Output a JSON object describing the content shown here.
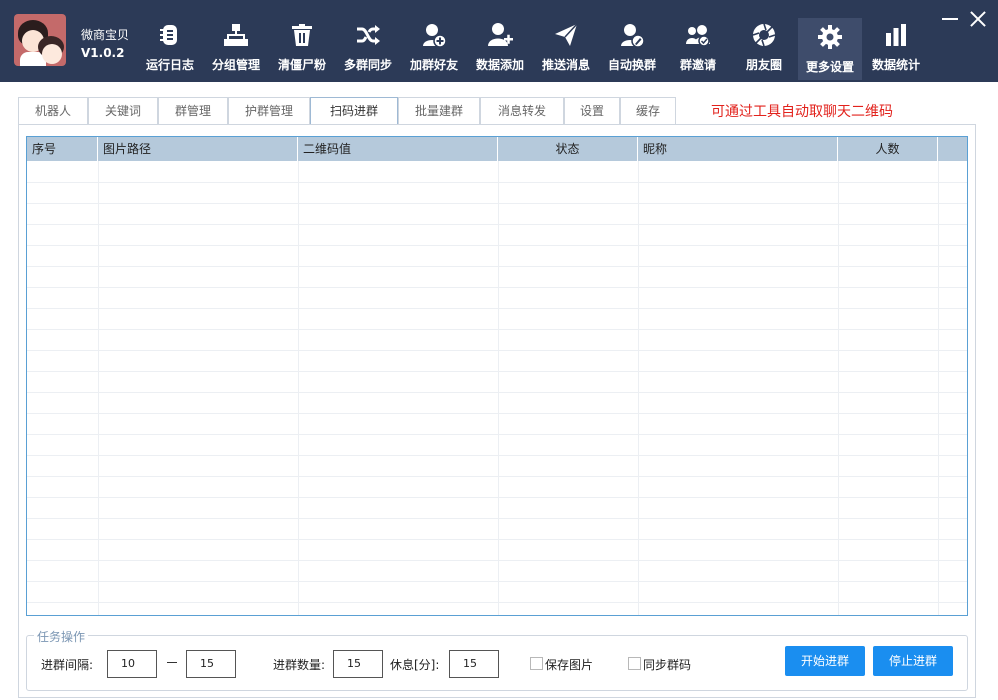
{
  "app": {
    "name": "微商宝贝",
    "version": "V1.0.2"
  },
  "toolbar": {
    "items": [
      {
        "label": "运行日志",
        "icon": "log-icon"
      },
      {
        "label": "分组管理",
        "icon": "hierarchy-icon"
      },
      {
        "label": "清僵尸粉",
        "icon": "trash-icon"
      },
      {
        "label": "多群同步",
        "icon": "shuffle-icon"
      },
      {
        "label": "加群好友",
        "icon": "add-friend-icon"
      },
      {
        "label": "数据添加",
        "icon": "add-user-icon"
      },
      {
        "label": "推送消息",
        "icon": "send-icon"
      },
      {
        "label": "自动换群",
        "icon": "user-edit-icon"
      },
      {
        "label": "群邀请",
        "icon": "group-invite-icon"
      },
      {
        "label": "朋友圈",
        "icon": "camera-aperture-icon"
      },
      {
        "label": "更多设置",
        "icon": "gear-icon",
        "active": true
      },
      {
        "label": "数据统计",
        "icon": "bar-chart-icon"
      }
    ]
  },
  "tabs": {
    "items": [
      "机器人",
      "关键词",
      "群管理",
      "护群管理",
      "扫码进群",
      "批量建群",
      "消息转发",
      "设置",
      "缓存"
    ],
    "active": "扫码进群",
    "hint": "可通过工具自动取聊天二维码"
  },
  "grid": {
    "columns": [
      "序号",
      "图片路径",
      "二维码值",
      "状态",
      "昵称",
      "人数"
    ],
    "rows": []
  },
  "task": {
    "title": "任务操作",
    "interval_label": "进群间隔:",
    "interval_min": "10",
    "interval_max": "15",
    "count_label": "进群数量:",
    "count_value": "15",
    "rest_label": "休息[分]:",
    "rest_value": "15",
    "save_image_label": "保存图片",
    "save_image_checked": false,
    "sync_code_label": "同步群码",
    "sync_code_checked": false,
    "start_button": "开始进群",
    "stop_button": "停止进群"
  },
  "colors": {
    "header_bg": "#2c3a57",
    "active_tool_bg": "#3e4c6b",
    "grid_header_bg": "#b5c9db",
    "grid_border": "#5aa0d4",
    "hint_text": "#e2221c",
    "button_bg": "#1a8ef0"
  }
}
